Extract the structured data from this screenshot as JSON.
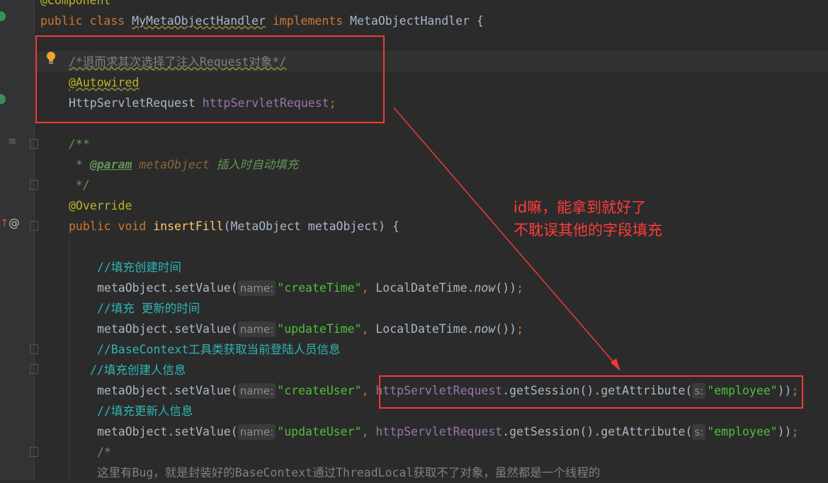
{
  "editor": {
    "lines": [
      {
        "indent": 57,
        "tokens": [
          {
            "t": "@Component",
            "k": "ann"
          }
        ]
      },
      {
        "indent": 57,
        "tokens": [
          {
            "t": "public class ",
            "k": "kw"
          },
          {
            "t": "MyMetaObjectHandler",
            "k": "cls wavy"
          },
          {
            "t": " implements ",
            "k": "kw"
          },
          {
            "t": "MetaObjectHandler {",
            "k": "cls"
          }
        ]
      },
      {
        "indent": 57,
        "tokens": []
      },
      {
        "indent": 97,
        "tokens": [
          {
            "t": "/*退而求其次选择了注入Request对象*/",
            "k": "cmt wavy"
          }
        ]
      },
      {
        "indent": 97,
        "tokens": [
          {
            "t": "@Autowired",
            "k": "ann wavy"
          }
        ]
      },
      {
        "indent": 97,
        "tokens": [
          {
            "t": "HttpServletRequest ",
            "k": "cls"
          },
          {
            "t": "httpServletRequest",
            "k": "fld"
          },
          {
            "t": ";",
            "k": "punc"
          }
        ]
      },
      {
        "indent": 97,
        "tokens": []
      },
      {
        "indent": 97,
        "tokens": [
          {
            "t": "/**",
            "k": "doc"
          }
        ]
      },
      {
        "indent": 97,
        "tokens": [
          {
            "t": " * ",
            "k": "doc"
          },
          {
            "t": "@param",
            "k": "doctag"
          },
          {
            "t": " metaObject",
            "k": "docparam"
          },
          {
            "t": " 插入时自动填充",
            "k": "doc"
          }
        ]
      },
      {
        "indent": 97,
        "tokens": [
          {
            "t": " */",
            "k": "doc"
          }
        ]
      },
      {
        "indent": 97,
        "tokens": [
          {
            "t": "@Override",
            "k": "ann"
          }
        ]
      },
      {
        "indent": 97,
        "tokens": [
          {
            "t": "public void ",
            "k": "kw"
          },
          {
            "t": "insertFill",
            "k": "mth"
          },
          {
            "t": "(MetaObject metaObject) {",
            "k": "cls"
          }
        ]
      },
      {
        "indent": 137,
        "tokens": []
      },
      {
        "indent": 137,
        "tokens": [
          {
            "t": "//填充创建时间",
            "k": "lc"
          }
        ]
      },
      {
        "indent": 137,
        "tokens": [
          {
            "t": "metaObject.setValue(",
            "k": "cls"
          },
          {
            "h": "name:"
          },
          {
            "t": "\"createTime\"",
            "k": "str"
          },
          {
            "t": ", ",
            "k": "punc"
          },
          {
            "t": "LocalDateTime.",
            "k": "cls"
          },
          {
            "t": "now",
            "k": "cls ital"
          },
          {
            "t": "())",
            "k": "cls"
          },
          {
            "t": ";",
            "k": "punc"
          }
        ]
      },
      {
        "indent": 137,
        "tokens": [
          {
            "t": "//填充 更新的时间",
            "k": "lc"
          }
        ]
      },
      {
        "indent": 137,
        "tokens": [
          {
            "t": "metaObject.setValue(",
            "k": "cls"
          },
          {
            "h": "name:"
          },
          {
            "t": "\"updateTime\"",
            "k": "str"
          },
          {
            "t": ", ",
            "k": "punc"
          },
          {
            "t": "LocalDateTime.",
            "k": "cls"
          },
          {
            "t": "now",
            "k": "cls ital"
          },
          {
            "t": "())",
            "k": "cls"
          },
          {
            "t": ";",
            "k": "punc"
          }
        ]
      },
      {
        "indent": 137,
        "tokens": [
          {
            "t": "//BaseContext工具类获取当前登陆人员信息",
            "k": "lc"
          }
        ]
      },
      {
        "indent": 127,
        "tokens": [
          {
            "t": "//填充创建人信息",
            "k": "lc"
          }
        ]
      },
      {
        "indent": 137,
        "tokens": [
          {
            "t": "metaObject.setValue(",
            "k": "cls"
          },
          {
            "h": "name:"
          },
          {
            "t": "\"createUser\"",
            "k": "str"
          },
          {
            "t": ", ",
            "k": "punc"
          },
          {
            "t": "httpServletRequest",
            "k": "fld"
          },
          {
            "t": ".getSession().getAttribute(",
            "k": "cls"
          },
          {
            "h": "s:"
          },
          {
            "t": "\"employee\"",
            "k": "str"
          },
          {
            "t": "))",
            "k": "cls"
          },
          {
            "t": ";",
            "k": "punc"
          }
        ]
      },
      {
        "indent": 137,
        "tokens": [
          {
            "t": "//填充更新人信息",
            "k": "lc"
          }
        ]
      },
      {
        "indent": 137,
        "tokens": [
          {
            "t": "metaObject.setValue(",
            "k": "cls"
          },
          {
            "h": "name:"
          },
          {
            "t": "\"updateUser\"",
            "k": "str"
          },
          {
            "t": ", ",
            "k": "punc"
          },
          {
            "t": "httpServletRequest",
            "k": "fld"
          },
          {
            "t": ".getSession().getAttribute(",
            "k": "cls"
          },
          {
            "h": "s:"
          },
          {
            "t": "\"employee\"",
            "k": "str"
          },
          {
            "t": "))",
            "k": "cls"
          },
          {
            "t": ";",
            "k": "punc"
          }
        ]
      },
      {
        "indent": 137,
        "tokens": [
          {
            "t": "/*",
            "k": "cmt"
          }
        ]
      },
      {
        "indent": 137,
        "tokens": [
          {
            "t": "这里有Bug，就是封装好的BaseContext通过ThreadLocal获取不了对象，虽然都是一个线程的",
            "k": "cmt"
          }
        ]
      }
    ]
  },
  "annotation": {
    "line1": "id嘛，能拿到就好了",
    "line2": "不耽误其他的字段填充",
    "color": "#ff3b3b"
  },
  "gutter_icons": [
    "implementing-icon",
    "implementing-icon",
    "structure-icon",
    "override-icon",
    "at-icon",
    "bulb-icon"
  ]
}
